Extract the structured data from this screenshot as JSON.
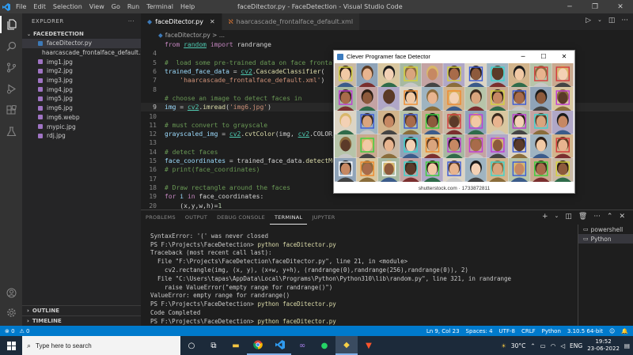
{
  "titlebar": {
    "menu": [
      "File",
      "Edit",
      "Selection",
      "View",
      "Go",
      "Run",
      "Terminal",
      "Help"
    ],
    "title": "faceDitector.py - FaceDetection - Visual Studio Code"
  },
  "explorer": {
    "header": "EXPLORER",
    "folder": "FACEDETECTION",
    "files": [
      {
        "name": "faceDitector.py",
        "color": "#3d7ab8"
      },
      {
        "name": "haarcascade_frontalface_default.xml",
        "color": "#e37933"
      },
      {
        "name": "img1.jpg",
        "color": "#a074c4"
      },
      {
        "name": "img2.jpg",
        "color": "#a074c4"
      },
      {
        "name": "img3.jpg",
        "color": "#a074c4"
      },
      {
        "name": "img4.jpg",
        "color": "#a074c4"
      },
      {
        "name": "img5.jpg",
        "color": "#a074c4"
      },
      {
        "name": "img6.jpg",
        "color": "#a074c4"
      },
      {
        "name": "img6.webp",
        "color": "#a074c4"
      },
      {
        "name": "mypic.jpg",
        "color": "#a074c4"
      },
      {
        "name": "rdj.jpg",
        "color": "#a074c4"
      }
    ],
    "outline": "OUTLINE",
    "timeline": "TIMELINE"
  },
  "tabs": [
    {
      "label": "faceDitector.py",
      "active": true
    },
    {
      "label": "haarcascade_frontalface_default.xml",
      "active": false
    }
  ],
  "breadcrumb": "faceDitector.py > ...",
  "code": {
    "current_line": "9",
    "lines": [
      {
        "n": "",
        "html": "<span class='k'>from</span> <span class='m u'>random</span> <span class='k'>import</span> <span class='txt'>randrange</span>"
      },
      {
        "n": "4",
        "html": ""
      },
      {
        "n": "5",
        "html": "<span class='c'>#  load some pre-trained data on face frontal</span>"
      },
      {
        "n": "6",
        "html": "<span class='v'>trained_face_data</span> <span class='txt'>=</span> <span class='m u'>cv2</span><span class='txt'>.</span><span class='f'>CascadeClassifier</span><span class='txt'>(</span>"
      },
      {
        "n": "7",
        "html": "    <span class='s'>'haarcascade_frontalface_default.xml'</span><span class='txt'>)</span>"
      },
      {
        "n": "8",
        "html": ""
      },
      {
        "n": "",
        "html": "<span class='c'># choose an image to detect faces in</span>"
      },
      {
        "n": "9",
        "html": "<span class='v'>img</span> <span class='txt'>=</span> <span class='m u'>cv2</span><span class='txt'>.</span><span class='f'>imread</span><span class='txt'>(</span><span class='s'>'img6.jpg'</span><span class='txt'>)</span>"
      },
      {
        "n": "10",
        "html": ""
      },
      {
        "n": "11",
        "html": "<span class='c'># must convert to grayscale</span>"
      },
      {
        "n": "12",
        "html": "<span class='v'>grayscaled_img</span> <span class='txt'>=</span> <span class='m u'>cv2</span><span class='txt'>.</span><span class='f'>cvtColor</span><span class='txt'>(img, </span><span class='m u'>cv2</span><span class='txt'>.COLOR_</span>"
      },
      {
        "n": "13",
        "html": ""
      },
      {
        "n": "14",
        "html": "<span class='c'># detect faces</span>"
      },
      {
        "n": "15",
        "html": "<span class='v'>face_coordinates</span> <span class='txt'>=</span> <span class='txt'>trained_face_data.</span><span class='f'>detectMu</span>"
      },
      {
        "n": "16",
        "html": "<span class='c'># print(face_coordinates)</span>"
      },
      {
        "n": "17",
        "html": ""
      },
      {
        "n": "18",
        "html": "<span class='c'># Draw rectangle around the faces</span>"
      },
      {
        "n": "19",
        "html": "<span class='k'>for</span> <span class='v'>i</span> <span class='k'>in</span> <span class='txt'>face_coordinates:</span>"
      },
      {
        "n": "20",
        "html": "    <span class='txt'>(x,y,w,h)=</span><span class='n'>1</span>"
      }
    ]
  },
  "popup": {
    "title": "Clever Programer face Detector",
    "credit": "shutterstock.com · 1733872811",
    "box_colors": [
      "#3ad13a",
      "#d63a3a",
      "#3a5ad6",
      "#c03ad6",
      "#d6d23a",
      "#3ad6cf",
      "#ffffff",
      "#f08a2b"
    ]
  },
  "panel": {
    "tabs": [
      "PROBLEMS",
      "OUTPUT",
      "DEBUG CONSOLE",
      "TERMINAL",
      "JUPYTER"
    ],
    "active_tab": "TERMINAL",
    "terminal_lines": [
      "SyntaxError: '(' was never closed",
      "PS F:\\Projects\\FaceDetection> python faceDitector.py",
      "Traceback (most recent call last):",
      "  File \"F:\\Projects\\FaceDetection\\faceDitector.py\", line 21, in <module>",
      "    cv2.rectangle(img, (x, y), (x+w, y+h), (randrange(0),randrange(256),randrange(0)), 2)",
      "  File \"C:\\Users\\tapas\\AppData\\Local\\Programs\\Python\\Python310\\lib\\random.py\", line 321, in randrange",
      "    raise ValueError(\"empty range for randrange()\")",
      "ValueError: empty range for randrange()",
      "PS F:\\Projects\\FaceDetection> python faceDitector.py",
      "Code Completed",
      "PS F:\\Projects\\FaceDetection> python faceDitector.py",
      "▯"
    ],
    "terminals": [
      "powershell",
      "Python"
    ]
  },
  "status": {
    "left": [
      "⊗ 0",
      "⚠ 0"
    ],
    "right": [
      "Ln 9, Col 23",
      "Spaces: 4",
      "UTF-8",
      "CRLF",
      "Python",
      "3.10.5 64-bit"
    ]
  },
  "taskbar": {
    "search_placeholder": "Type here to search",
    "weather": "30°C",
    "lang": "ENG",
    "time": "19:52",
    "date": "23-06-2022"
  }
}
